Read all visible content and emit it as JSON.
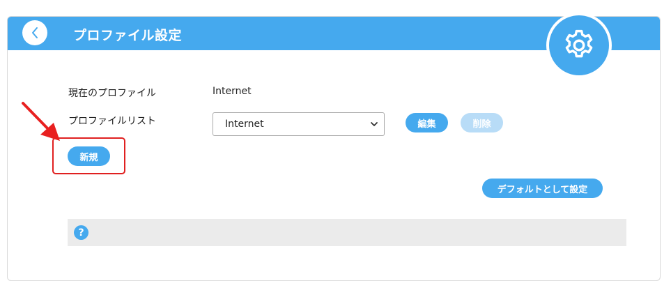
{
  "header": {
    "title": "プロファイル設定",
    "back_icon": "chevron-left-icon",
    "settings_icon": "gear-icon"
  },
  "profile": {
    "current_label": "現在のプロファイル",
    "current_value": "Internet",
    "list_label": "プロファイルリスト",
    "list_selected": "Internet"
  },
  "buttons": {
    "edit": "編集",
    "delete": "削除",
    "new": "新規",
    "set_default": "デフォルトとして設定"
  },
  "help": {
    "icon_text": "?"
  },
  "colors": {
    "accent": "#45a9ee",
    "accent_disabled": "#b8dcf7",
    "highlight": "#e02020",
    "help_bar": "#ebebeb"
  }
}
